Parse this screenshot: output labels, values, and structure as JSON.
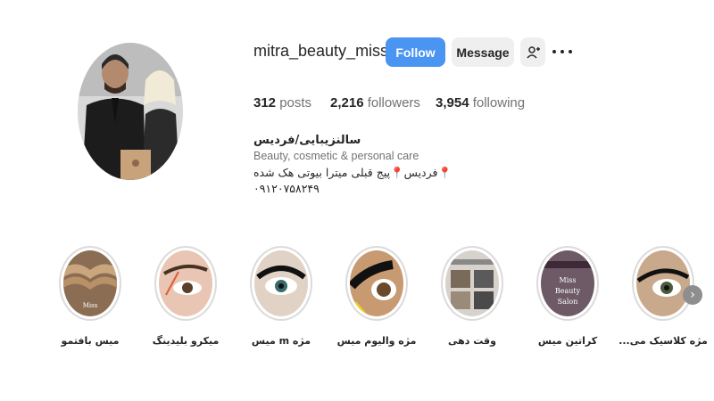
{
  "profile": {
    "username": "mitra_beauty_miss",
    "follow_label": "Follow",
    "message_label": "Message",
    "posts_count": "312",
    "posts_label": "posts",
    "followers_count": "2,216",
    "followers_label": "followers",
    "following_count": "3,954",
    "following_label": "following"
  },
  "bio": {
    "name": "سالنزیبایی/فردیس",
    "category": "Beauty, cosmetic & personal care",
    "line": "📍فردیس📍پیج قبلی میترا بیوتی هک شده",
    "phone": "۰۹۱۲۰۷۵۸۲۴۹"
  },
  "highlights": [
    {
      "label": "میس بافتمو",
      "icon": "hair-braid-image"
    },
    {
      "label": "میکرو بلیدینگ",
      "icon": "eyebrow-image"
    },
    {
      "label": "مژه m میس",
      "icon": "eyelash-image"
    },
    {
      "label": "مژه والیوم میس",
      "icon": "volume-lash-image"
    },
    {
      "label": "وقت دهی",
      "icon": "appointment-image"
    },
    {
      "label": "کراتین میس",
      "icon": "miss-beauty-salon-image",
      "image_text": [
        "Miss",
        "Beauty",
        "Salon"
      ]
    },
    {
      "label": "مژه کلاسیک می...",
      "icon": "classic-lash-image"
    }
  ],
  "colors": {
    "follow_button": "#4a94f2",
    "secondary_button": "#efefef",
    "muted_text": "#737373"
  }
}
